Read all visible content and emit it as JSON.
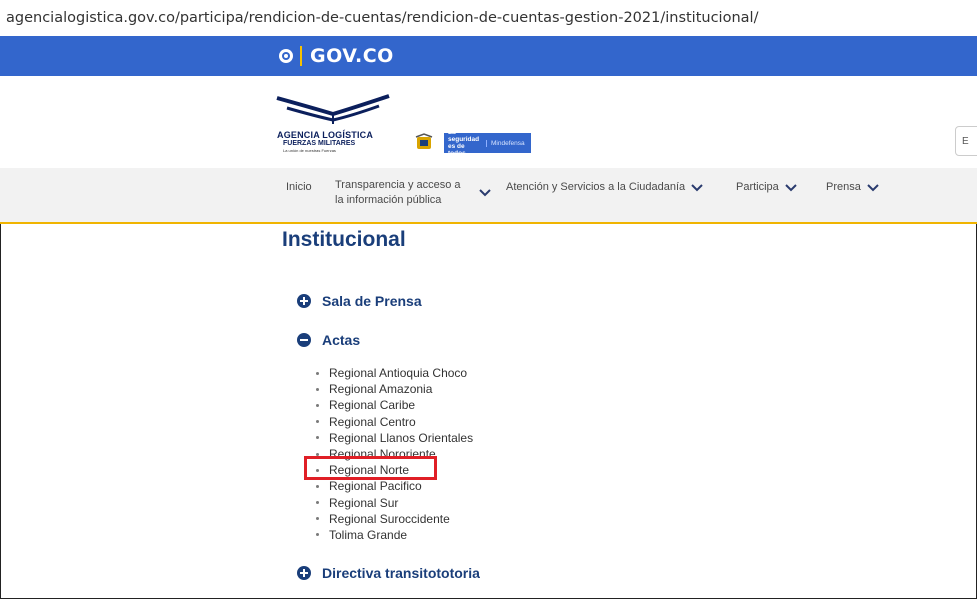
{
  "browser": {
    "url": "agencialogistica.gov.co/participa/rendicion-de-cuentas/rendicion-de-cuentas-gestion-2021/institucional/"
  },
  "gov_bar": {
    "logo_text": "GOV.CO",
    "color": "#3366cc"
  },
  "brand": {
    "agency_name": "AGENCIA LOGÍSTICA",
    "agency_sub": "FUERZAS MILITARES",
    "agency_tagline": "La unión de nuestras Fuerzas",
    "mindefensa_slogan": "La seguridad es de todos",
    "mindefensa_name": "Mindefensa"
  },
  "nav": {
    "items": [
      {
        "label": "Inicio",
        "has_dropdown": false
      },
      {
        "label": "Transparencia y acceso a la información pública",
        "has_dropdown": true
      },
      {
        "label": "Atención y Servicios a la Ciudadanía",
        "has_dropdown": true
      },
      {
        "label": "Participa",
        "has_dropdown": true
      },
      {
        "label": "Prensa",
        "has_dropdown": true
      }
    ]
  },
  "page": {
    "title": "Institucional",
    "sections": [
      {
        "label": "Sala de Prensa",
        "icon": "plus-circle-icon",
        "expanded": false
      },
      {
        "label": "Actas",
        "icon": "minus-circle-icon",
        "expanded": true
      },
      {
        "label": "Directiva transitototoria",
        "icon": "plus-circle-icon",
        "expanded": false
      }
    ],
    "actas_items": [
      "Regional Antioquia Choco",
      "Regional Amazonia",
      "Regional Caribe",
      "Regional Centro",
      "Regional Llanos Orientales",
      "Regional Nororiente",
      "Regional Norte",
      "Regional Pacifico",
      "Regional Sur",
      "Regional Suroccidente",
      "Tolima Grande"
    ],
    "highlighted_item": "Regional Norte",
    "highlight_color": "#e01f26",
    "accent_color": "#1a3e7a"
  }
}
